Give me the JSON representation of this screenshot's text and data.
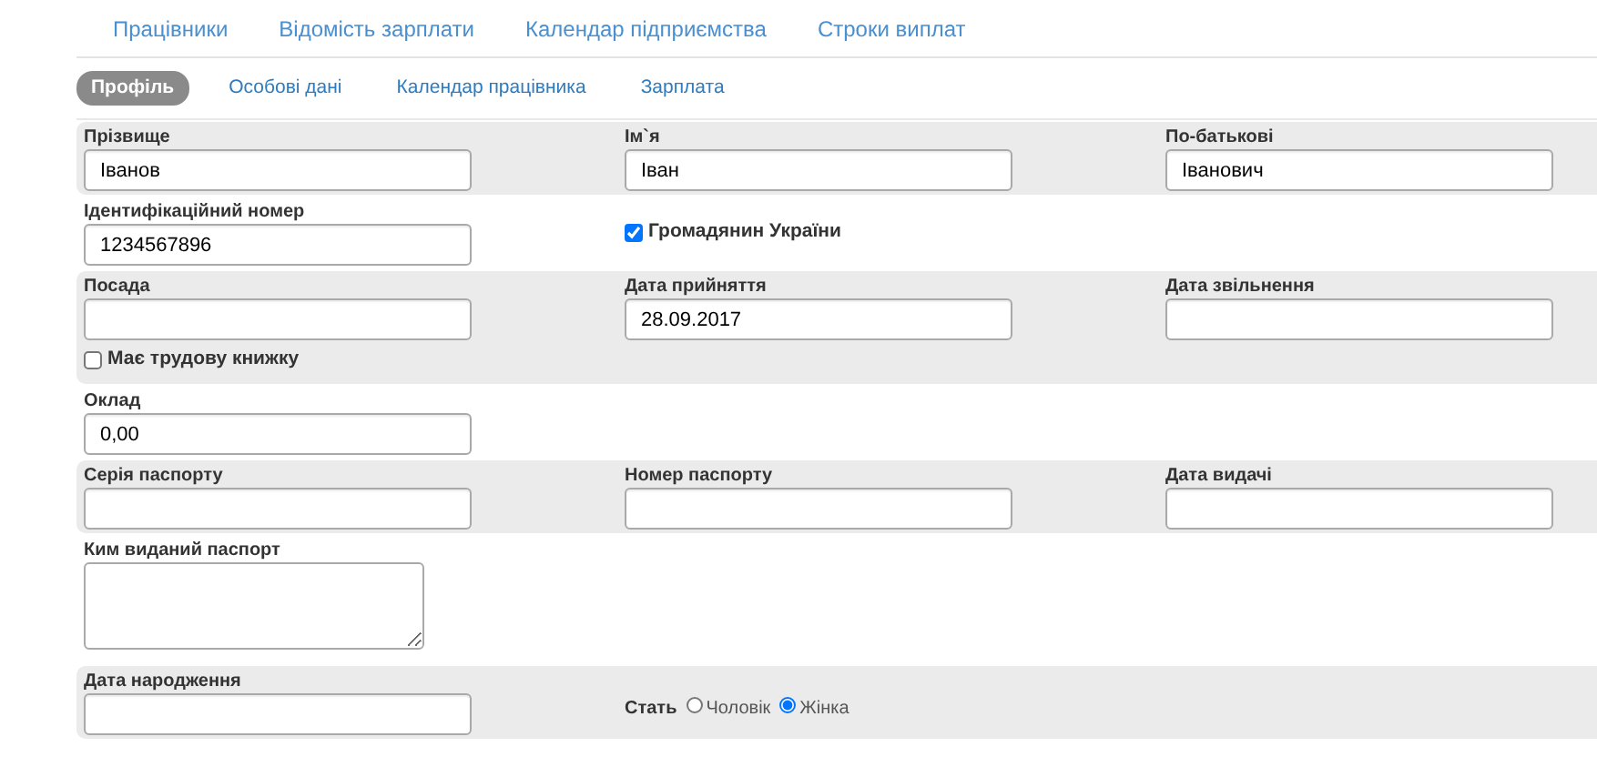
{
  "top_nav": [
    {
      "label": "Працівники",
      "selected": false
    },
    {
      "label": "Відомість зарплати",
      "selected": false
    },
    {
      "label": "Календар підприємства",
      "selected": false
    },
    {
      "label": "Строки виплат",
      "selected": false
    }
  ],
  "sub_tabs": [
    {
      "label": "Профіль",
      "selected": true
    },
    {
      "label": "Особові дані",
      "selected": false
    },
    {
      "label": "Календар працівника",
      "selected": false
    },
    {
      "label": "Зарплата",
      "selected": false
    }
  ],
  "sections": [
    {
      "shaded": true,
      "lines": [
        [
          {
            "kind": "field",
            "label": "Прізвище",
            "value": "Іванов"
          },
          {
            "kind": "field",
            "label": "Ім`я",
            "value": "Іван"
          },
          {
            "kind": "field",
            "label": "По-батькові",
            "value": "Іванович"
          }
        ]
      ]
    },
    {
      "shaded": false,
      "lines": [
        [
          {
            "kind": "field",
            "label": "Ідентифікаційний номер",
            "value": "1234567896"
          },
          {
            "kind": "checkbox",
            "label": "Громадянин України",
            "checked": true
          },
          {
            "kind": "blank"
          }
        ]
      ]
    },
    {
      "shaded": true,
      "lines": [
        [
          {
            "kind": "field",
            "label": "Посада"
          },
          {
            "kind": "field",
            "label": "Дата прийняття",
            "value": "28.09.2017"
          },
          {
            "kind": "field",
            "label": "Дата звільнення"
          }
        ],
        [
          {
            "kind": "checkbox",
            "label": "Має трудову книжку",
            "checked": false
          },
          {
            "kind": "blank"
          },
          {
            "kind": "blank"
          }
        ]
      ]
    },
    {
      "shaded": false,
      "lines": [
        [
          {
            "kind": "field",
            "label": "Оклад",
            "value": "0,00"
          },
          {
            "kind": "blank"
          },
          {
            "kind": "blank"
          }
        ]
      ]
    },
    {
      "shaded": true,
      "lines": [
        [
          {
            "kind": "field",
            "label": "Серія паспорту"
          },
          {
            "kind": "field",
            "label": "Номер паспорту"
          },
          {
            "kind": "field",
            "label": "Дата видачі"
          }
        ]
      ]
    },
    {
      "shaded": false,
      "lines": [
        [
          {
            "kind": "textarea",
            "label": "Ким виданий паспорт"
          },
          {
            "kind": "blank"
          },
          {
            "kind": "blank"
          }
        ]
      ]
    },
    {
      "shaded": true,
      "lines": [
        [
          {
            "kind": "field",
            "label": "Дата народження"
          },
          {
            "kind": "radio_group",
            "label": "Стать",
            "options": [
              {
                "label": "Чоловік",
                "selected": false
              },
              {
                "label": "Жінка",
                "selected": true
              }
            ]
          },
          {
            "kind": "blank"
          }
        ]
      ]
    }
  ]
}
